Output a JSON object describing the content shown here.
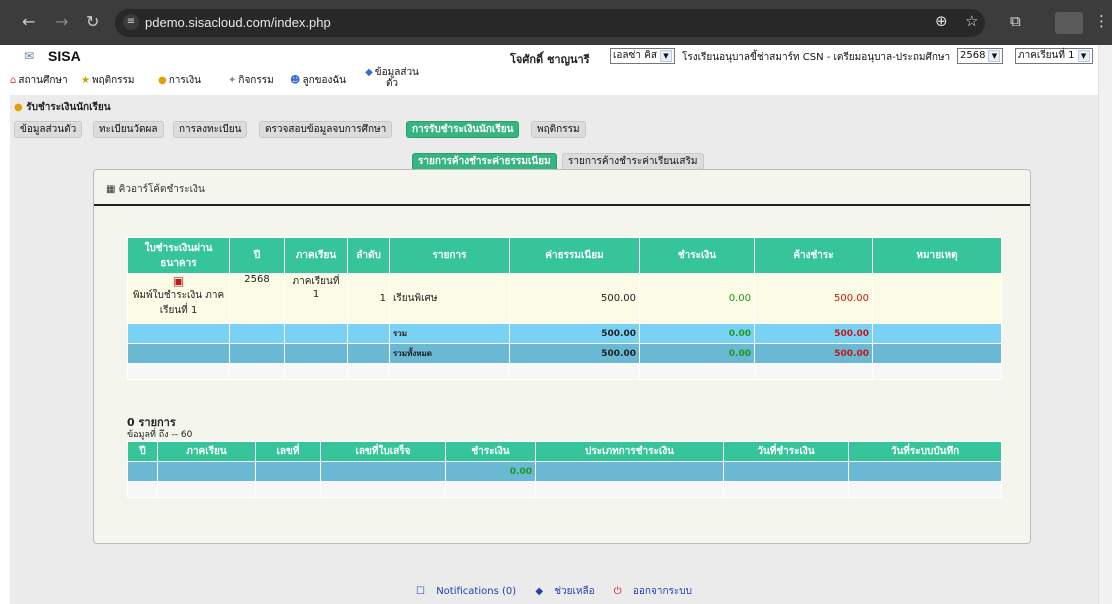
{
  "browser": {
    "url": "pdemo.sisacloud.com/index.php"
  },
  "header": {
    "logo": "SISA",
    "user": "โจศักดิ์ ชาญนารี",
    "role_select": "เอลซ่า คิส",
    "school": "โรงเรียนอนุบาลขี้ช่าสมาร์ท CSN - เตรียมอนุบาล-ประถมศึกษา",
    "year_select": "2568",
    "term_select": "ภาคเรียนที่ 1"
  },
  "menu": {
    "items": [
      "สถานศึกษา",
      "พฤติกรรม",
      "การเงิน",
      "กิจกรรม",
      "ลูกของฉัน",
      "ข้อมูลส่วนตัว"
    ]
  },
  "breadcrumb": "รับชำระเงินนักเรียน",
  "tabs": [
    "ข้อมูลส่วนตัว",
    "ทะเบียนวัดผล",
    "การลงทะเบียน",
    "ตรวจสอบข้อมูลจบการศึกษา",
    "การรับชำระเงินนักเรียน",
    "พฤติกรรม"
  ],
  "subtabs": [
    "รายการค้างชำระค่าธรรมเนียม",
    "รายการค้างชำระค่าเรียนเสริม"
  ],
  "panel": {
    "title": "คิวอาร์โค้ดชำระเงิน"
  },
  "fee_table": {
    "headers": [
      "ใบชำระเงินผ่านธนาคาร",
      "ปี",
      "ภาคเรียน",
      "ลำดับ",
      "รายการ",
      "ค่าธรรมเนียม",
      "ชำระเงิน",
      "ค้างชำระ",
      "หมายเหตุ"
    ],
    "row": {
      "print_label": "พิมพ์ใบชำระเงิน ภาคเรียนที่ 1",
      "year": "2568",
      "term": "ภาคเรียนที่ 1",
      "seq": "1",
      "item": "เรียนพิเศษ",
      "fee": "500.00",
      "paid": "0.00",
      "due": "500.00",
      "note": ""
    },
    "total": {
      "label": "รวม",
      "fee": "500.00",
      "paid": "0.00",
      "due": "500.00"
    },
    "grand": {
      "label": "รวมทั้งหมด",
      "fee": "500.00",
      "paid": "0.00",
      "due": "500.00"
    }
  },
  "payments": {
    "count": "0 รายการ",
    "range": "ข้อมูลที่ ถึง -- 60",
    "headers": [
      "ปี",
      "ภาคเรียน",
      "เลขที่",
      "เลขที่ใบเสร็จ",
      "ชำระเงิน",
      "ประเภทการชำระเงิน",
      "วันที่ชำระเงิน",
      "วันที่ระบบบันทึก"
    ],
    "total_paid": "0.00"
  },
  "footer": {
    "notifications": "Notifications (0)",
    "help": "ช่วยเหลือ",
    "logout": "ออกจากระบบ"
  }
}
